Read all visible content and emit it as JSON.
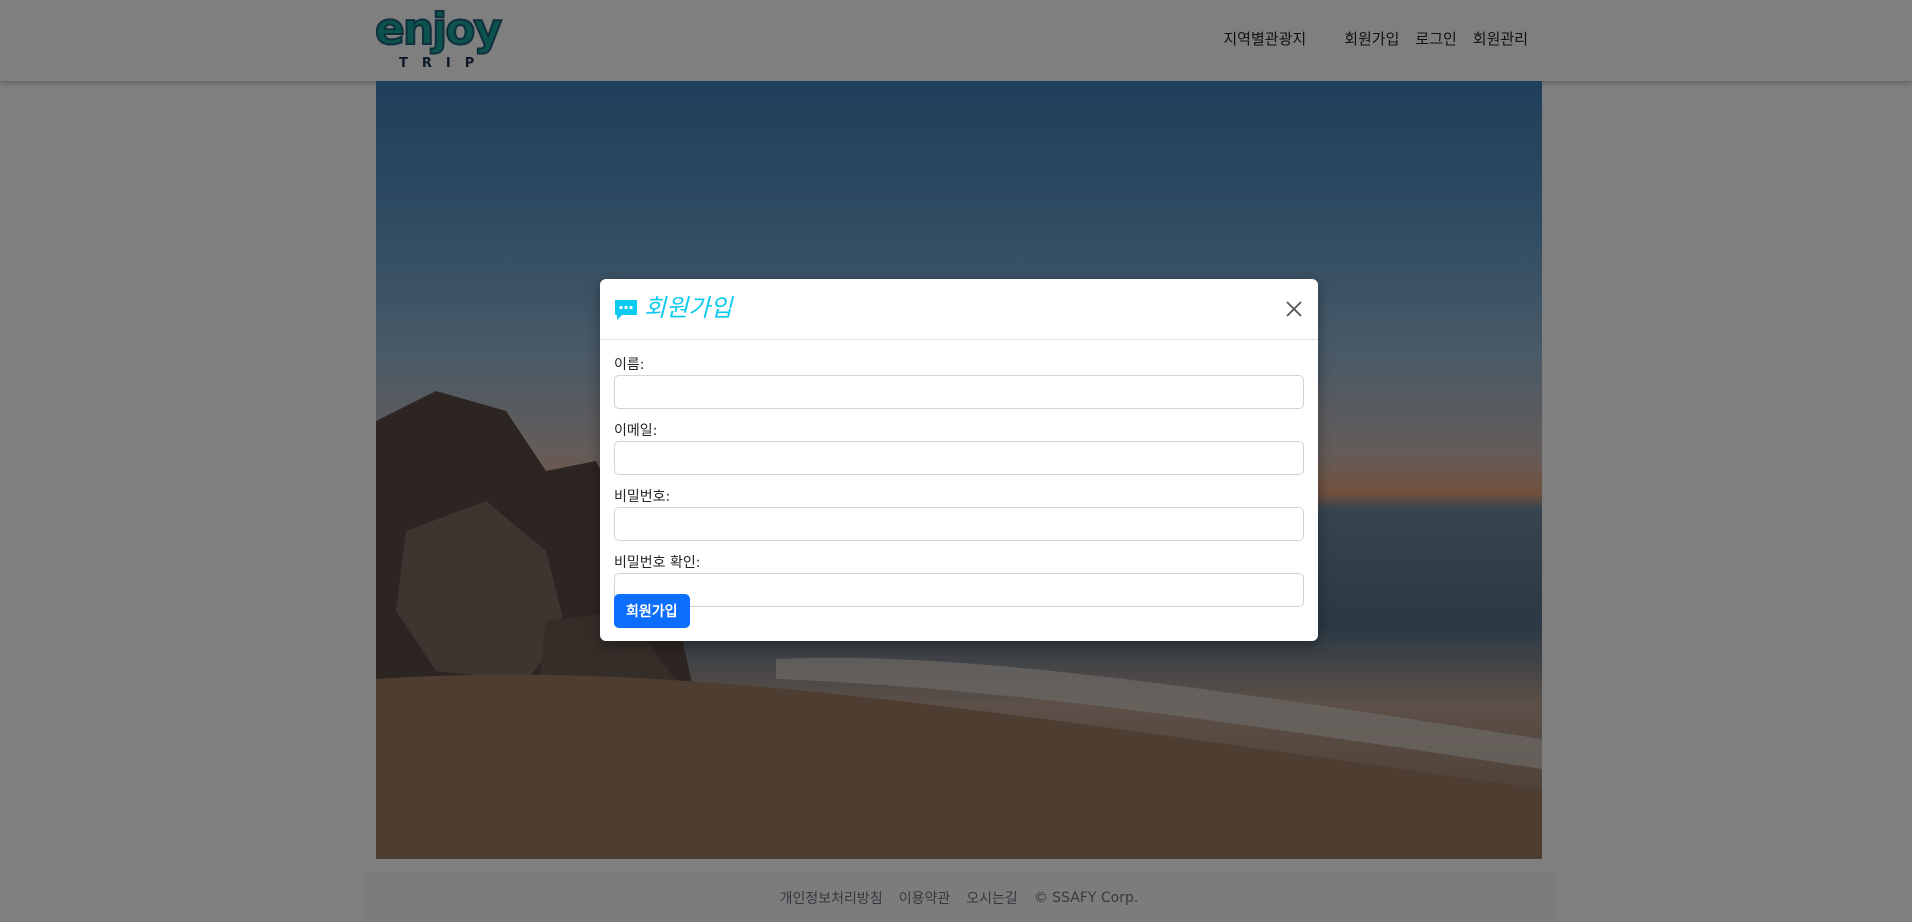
{
  "brand": {
    "logo_text": "enjoy",
    "logo_subtext": "TRIP"
  },
  "nav": {
    "items": [
      "지역별관광지",
      "회원가입",
      "로그인",
      "회원관리"
    ]
  },
  "footer": {
    "items": [
      "개인정보처리방침",
      "이용약관",
      "오시는길",
      "© SSAFY Corp."
    ]
  },
  "modal": {
    "title": "회원가입",
    "icon": "chat-dots-icon",
    "fields": [
      {
        "label": "이름:",
        "value": "",
        "placeholder": ""
      },
      {
        "label": "이메일:",
        "value": "",
        "placeholder": ""
      },
      {
        "label": "비밀번호:",
        "value": "",
        "placeholder": ""
      },
      {
        "label": "비밀번호 확인:",
        "value": "",
        "placeholder": ""
      }
    ],
    "submit_label": "회원가입"
  },
  "colors": {
    "accent": "#0dcaf0",
    "primary": "#0d6efd",
    "logo_green": "#1aa69a",
    "backdrop": "rgba(0,0,0,0.5)"
  }
}
